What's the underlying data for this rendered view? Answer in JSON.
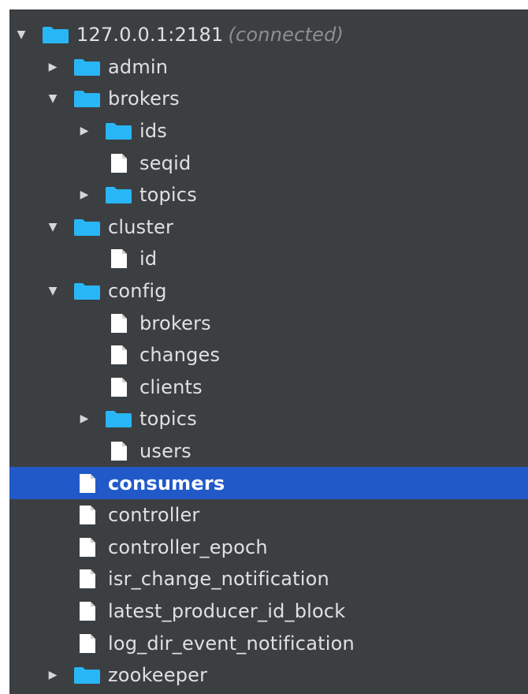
{
  "colors": {
    "panel_background": "#3c3f41",
    "selection": "#2159c8",
    "folder": "#29b6f6",
    "text": "#e0e0e0",
    "status_text": "#8f8f8f"
  },
  "tree": {
    "nodes": [
      {
        "id": "root",
        "label": "127.0.0.1:2181",
        "status": "(connected)",
        "type": "folder",
        "depth": 0,
        "expanded": true
      },
      {
        "id": "admin",
        "label": "admin",
        "type": "folder",
        "depth": 1,
        "expanded": false
      },
      {
        "id": "brokers",
        "label": "brokers",
        "type": "folder",
        "depth": 1,
        "expanded": true
      },
      {
        "id": "brokers-ids",
        "label": "ids",
        "type": "folder",
        "depth": 2,
        "expanded": false
      },
      {
        "id": "brokers-seqid",
        "label": "seqid",
        "type": "file",
        "depth": 2
      },
      {
        "id": "brokers-topics",
        "label": "topics",
        "type": "folder",
        "depth": 2,
        "expanded": false
      },
      {
        "id": "cluster",
        "label": "cluster",
        "type": "folder",
        "depth": 1,
        "expanded": true
      },
      {
        "id": "cluster-id",
        "label": "id",
        "type": "file",
        "depth": 2
      },
      {
        "id": "config",
        "label": "config",
        "type": "folder",
        "depth": 1,
        "expanded": true
      },
      {
        "id": "config-brokers",
        "label": "brokers",
        "type": "file",
        "depth": 2
      },
      {
        "id": "config-changes",
        "label": "changes",
        "type": "file",
        "depth": 2
      },
      {
        "id": "config-clients",
        "label": "clients",
        "type": "file",
        "depth": 2
      },
      {
        "id": "config-topics",
        "label": "topics",
        "type": "folder",
        "depth": 2,
        "expanded": false
      },
      {
        "id": "config-users",
        "label": "users",
        "type": "file",
        "depth": 2
      },
      {
        "id": "consumers",
        "label": "consumers",
        "type": "file",
        "depth": 1,
        "selected": true
      },
      {
        "id": "controller",
        "label": "controller",
        "type": "file",
        "depth": 1
      },
      {
        "id": "controller-epoch",
        "label": "controller_epoch",
        "type": "file",
        "depth": 1
      },
      {
        "id": "isr-change-notification",
        "label": "isr_change_notification",
        "type": "file",
        "depth": 1
      },
      {
        "id": "latest-producer-id-block",
        "label": "latest_producer_id_block",
        "type": "file",
        "depth": 1
      },
      {
        "id": "log-dir-event-notification",
        "label": "log_dir_event_notification",
        "type": "file",
        "depth": 1
      },
      {
        "id": "zookeeper",
        "label": "zookeeper",
        "type": "folder",
        "depth": 1,
        "expanded": false
      }
    ]
  }
}
